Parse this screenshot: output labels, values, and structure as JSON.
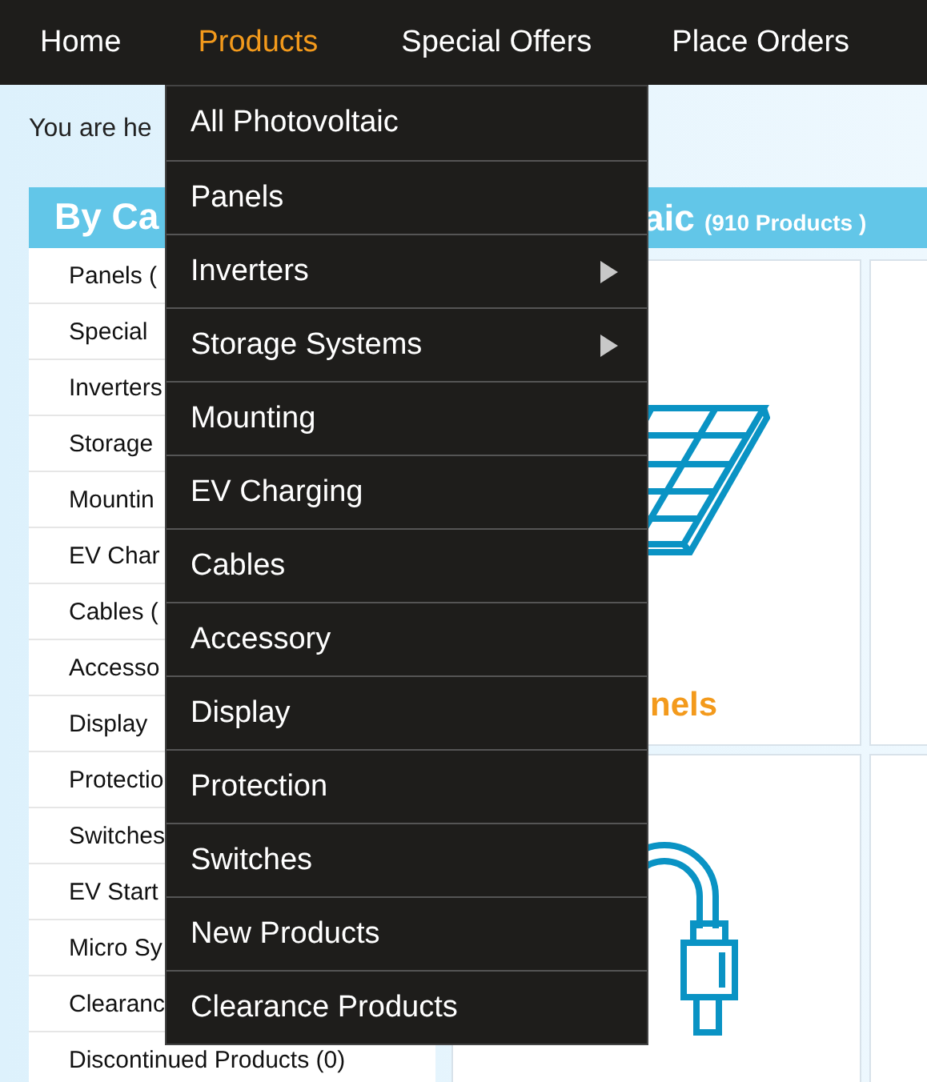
{
  "nav": [
    {
      "label": "Home",
      "selected": false
    },
    {
      "label": "Products",
      "selected": true
    },
    {
      "label": "Special Offers",
      "selected": false
    },
    {
      "label": "Place Orders",
      "selected": false
    }
  ],
  "breadcrumb": "You are he",
  "sidebar": {
    "title": "By Ca",
    "items": [
      "Panels (",
      "Special",
      "Inverters",
      "Storage",
      "Mountin",
      "EV Char",
      "Cables (",
      "Accesso",
      "Display",
      "Protectio",
      "Switches",
      "EV Start",
      "Micro Sy",
      "Clearanc",
      "Discontinued Products (0)"
    ]
  },
  "main": {
    "title": "aic",
    "count": "(910 Products )",
    "cards": [
      {
        "kind": "panel",
        "title": "nels"
      },
      {
        "kind": "empty"
      },
      {
        "kind": "cable"
      },
      {
        "kind": "empty"
      }
    ]
  },
  "dropdown": [
    {
      "label": "All Photovoltaic",
      "submenu": false
    },
    {
      "label": "Panels",
      "submenu": false
    },
    {
      "label": "Inverters",
      "submenu": true
    },
    {
      "label": "Storage Systems",
      "submenu": true
    },
    {
      "label": "Mounting",
      "submenu": false
    },
    {
      "label": "EV Charging",
      "submenu": false
    },
    {
      "label": "Cables",
      "submenu": false
    },
    {
      "label": "Accessory",
      "submenu": false
    },
    {
      "label": "Display",
      "submenu": false
    },
    {
      "label": "Protection",
      "submenu": false
    },
    {
      "label": "Switches",
      "submenu": false
    },
    {
      "label": "New Products",
      "submenu": false
    },
    {
      "label": "Clearance Products",
      "submenu": false
    }
  ]
}
